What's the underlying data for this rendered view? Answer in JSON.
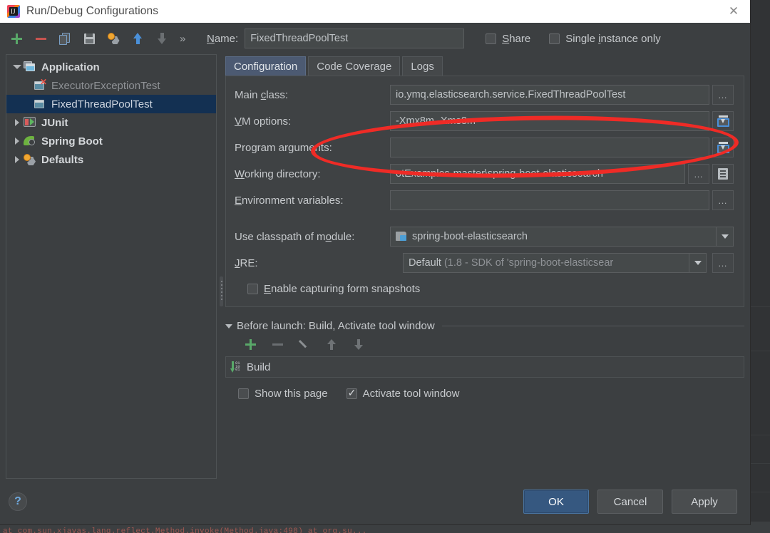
{
  "window": {
    "title": "Run/Debug Configurations",
    "app_icon": "intellij-idea-icon",
    "close_label": "✕"
  },
  "toolbar": {
    "icons": [
      {
        "name": "add-configuration-icon",
        "glyph": "plus"
      },
      {
        "name": "remove-configuration-icon",
        "glyph": "minus"
      },
      {
        "name": "copy-configuration-icon",
        "glyph": "copy"
      },
      {
        "name": "save-configuration-icon",
        "glyph": "save"
      },
      {
        "name": "edit-defaults-icon",
        "glyph": "gear"
      },
      {
        "name": "move-up-icon",
        "glyph": "arrow-up"
      },
      {
        "name": "move-down-icon",
        "glyph": "arrow-down"
      }
    ],
    "overflow_label": "»",
    "name_label": "Name:",
    "name_value": "FixedThreadPoolTest",
    "share_label": "Share",
    "share_checked": false,
    "single_instance_label": "Single instance only",
    "single_instance_checked": false
  },
  "sidebar": {
    "items": [
      {
        "label": "Application",
        "icon": "application-icon",
        "twisty": "open",
        "level": 0,
        "selected": false,
        "bold": true
      },
      {
        "label": "ExecutorExceptionTest",
        "icon": "run-config-error-icon",
        "twisty": "none",
        "level": 1,
        "selected": false,
        "muted": true
      },
      {
        "label": "FixedThreadPoolTest",
        "icon": "run-config-icon",
        "twisty": "none",
        "level": 1,
        "selected": true
      },
      {
        "label": "JUnit",
        "icon": "junit-icon",
        "twisty": "closed",
        "level": 0,
        "selected": false,
        "bold": true
      },
      {
        "label": "Spring Boot",
        "icon": "spring-boot-icon",
        "twisty": "closed",
        "level": 0,
        "selected": false,
        "bold": true
      },
      {
        "label": "Defaults",
        "icon": "defaults-gear-icon",
        "twisty": "closed",
        "level": 0,
        "selected": false,
        "bold": true
      }
    ]
  },
  "tabs": [
    {
      "label": "Configuration",
      "active": true
    },
    {
      "label": "Code Coverage",
      "active": false
    },
    {
      "label": "Logs",
      "active": false
    }
  ],
  "form": {
    "main_class": {
      "label": "Main class:",
      "value": "io.ymq.elasticsearch.service.FixedThreadPoolTest",
      "button": "…",
      "button_icon": "browse-ellipsis-icon"
    },
    "vm_options": {
      "label": "VM options:",
      "value": "-Xmx8m -Xms8m",
      "button_icon": "expand-editor-icon"
    },
    "program_arguments": {
      "label": "Program arguments:",
      "value": "",
      "button_icon": "expand-editor-icon"
    },
    "working_directory": {
      "label": "Working directory:",
      "value": "otExamples-master\\spring-boot-elasticsearch",
      "button": "…",
      "button_icon": "browse-ellipsis-icon",
      "macro_icon": "insert-macro-icon"
    },
    "environment_variables": {
      "label": "Environment variables:",
      "value": "",
      "button": "…",
      "button_icon": "browse-ellipsis-icon"
    },
    "classpath_module": {
      "label": "Use classpath of module:",
      "value": "spring-boot-elasticsearch",
      "icon": "module-folder-icon",
      "arrow_icon": "chevron-down-icon"
    },
    "jre": {
      "label": "JRE:",
      "value_strong": "Default",
      "value_dim": " (1.8 - SDK of 'spring-boot-elasticsear",
      "arrow_icon": "chevron-down-icon",
      "button": "…",
      "button_icon": "browse-ellipsis-icon"
    },
    "enable_snapshots": {
      "label": "Enable capturing form snapshots",
      "checked": false
    }
  },
  "before_launch": {
    "title": "Before launch: Build, Activate tool window",
    "twisty": "open",
    "toolbar": [
      {
        "name": "add-task-icon",
        "glyph": "plus"
      },
      {
        "name": "remove-task-icon",
        "glyph": "minus"
      },
      {
        "name": "edit-task-icon",
        "glyph": "pencil"
      },
      {
        "name": "move-task-up-icon",
        "glyph": "arrow-up"
      },
      {
        "name": "move-task-down-icon",
        "glyph": "arrow-down"
      }
    ],
    "tasks": [
      {
        "label": "Build",
        "icon": "build-task-icon"
      }
    ],
    "show_this_page": {
      "label": "Show this page",
      "checked": false
    },
    "activate_tool_window": {
      "label": "Activate tool window",
      "checked": true
    }
  },
  "footer": {
    "help_label": "?",
    "buttons": [
      {
        "label": "OK",
        "primary": true
      },
      {
        "label": "Cancel",
        "primary": false
      },
      {
        "label": "Apply",
        "primary": false
      }
    ]
  },
  "annotation": {
    "shape": "red-ellipse-highlight",
    "color": "#ef2b26",
    "targets": "vm-options-and-program-arguments-fields"
  },
  "console_strip": {
    "text": "at com.sun.xjavas.lang.reflect.Method.invoke(Method.java:498) at org.su..."
  }
}
